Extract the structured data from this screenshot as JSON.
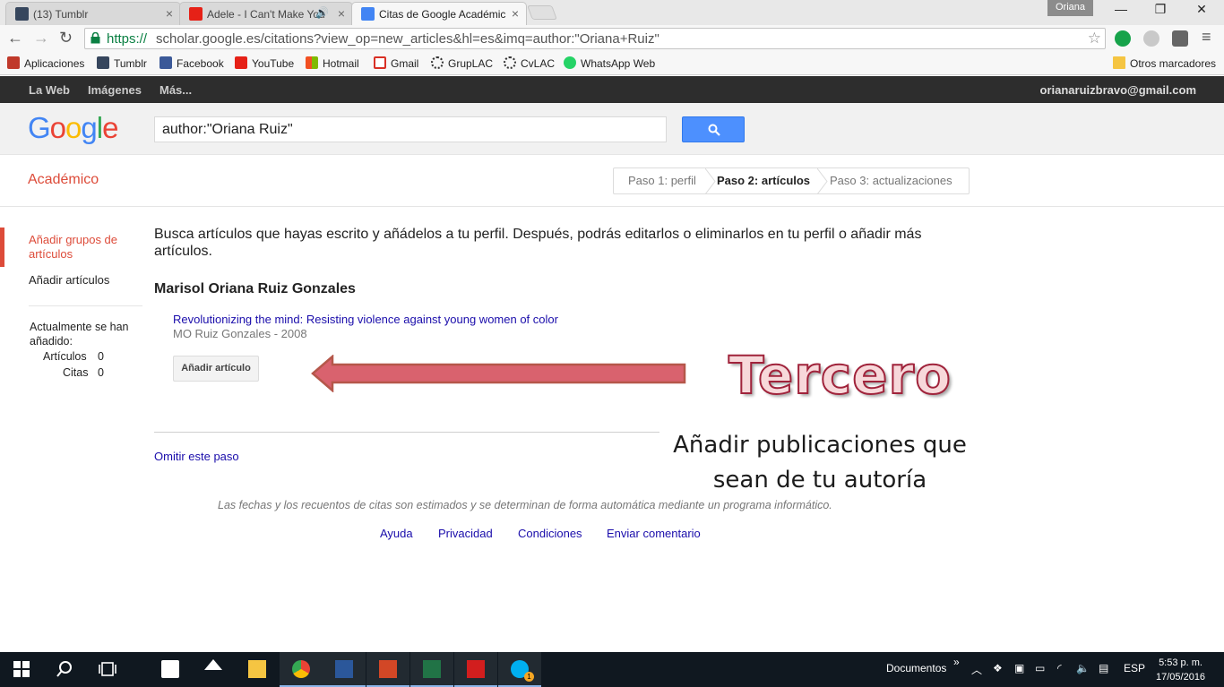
{
  "browser": {
    "tabs": [
      {
        "label": "(13) Tumblr",
        "close": "×"
      },
      {
        "label": "Adele - I Can't Make You",
        "close": "×"
      },
      {
        "label": "Citas de Google Académic",
        "close": "×"
      }
    ],
    "profile": "Oriana",
    "window_controls": {
      "minimize": "—",
      "restore": "❐",
      "close": "✕"
    },
    "url_scheme": "https://",
    "url_rest": "scholar.google.es/citations?view_op=new_articles&hl=es&imq=author:\"Oriana+Ruiz\"",
    "bookmarks": [
      {
        "label": "Aplicaciones",
        "color": "#c0392b"
      },
      {
        "label": "Tumblr",
        "color": "#36465d"
      },
      {
        "label": "Facebook",
        "color": "#3b5998"
      },
      {
        "label": "YouTube",
        "color": "#e62117"
      },
      {
        "label": "Hotmail",
        "color": "#f25022"
      },
      {
        "label": "Gmail",
        "color": "#d93025"
      },
      {
        "label": "GrupLAC",
        "color": "#333333"
      },
      {
        "label": "CvLAC",
        "color": "#333333"
      },
      {
        "label": "WhatsApp Web",
        "color": "#25d366"
      }
    ],
    "other_bookmarks": "Otros marcadores"
  },
  "gbar": {
    "links": [
      "La Web",
      "Imágenes",
      "Más..."
    ],
    "email": "orianaruizbravo@gmail.com"
  },
  "header": {
    "logo": "Google",
    "search_value": "author:\"Oriana Ruiz\""
  },
  "subheader": {
    "title": "Académico",
    "steps": [
      "Paso 1: perfil",
      "Paso 2: artículos",
      "Paso 3: actualizaciones"
    ]
  },
  "leftnav": {
    "add_groups": "Añadir grupos de artículos",
    "add_articles": "Añadir artículos",
    "added_label": "Actualmente se han añadido:",
    "articles_label": "Artículos",
    "articles_count": "0",
    "citations_label": "Citas",
    "citations_count": "0"
  },
  "main": {
    "intro": "Busca artículos que hayas escrito y añádelos a tu perfil. Después, podrás editarlos o eliminarlos en tu perfil o añadir más artículos.",
    "author": "Marisol Oriana Ruiz Gonzales",
    "article_title": "Revolutionizing the mind: Resisting violence against young women of color",
    "article_meta": "MO Ruiz Gonzales - 2008",
    "add_button": "Añadir artículo",
    "skip": "Omitir este paso",
    "disclaimer": "Las fechas y los recuentos de citas son estimados y se determinan de forma automática mediante un programa informático.",
    "footer_links": [
      "Ayuda",
      "Privacidad",
      "Condiciones",
      "Enviar comentario"
    ]
  },
  "annotation": {
    "heading": "Tercero",
    "text_line1": "Añadir publicaciones que",
    "text_line2": "sean de tu autoría",
    "arrow_color": "#d9626e"
  },
  "taskbar": {
    "documents": "Documentos",
    "overflow": "»",
    "language": "ESP",
    "time": "5:53 p. m.",
    "date": "17/05/2016",
    "skype_badge": "1"
  }
}
